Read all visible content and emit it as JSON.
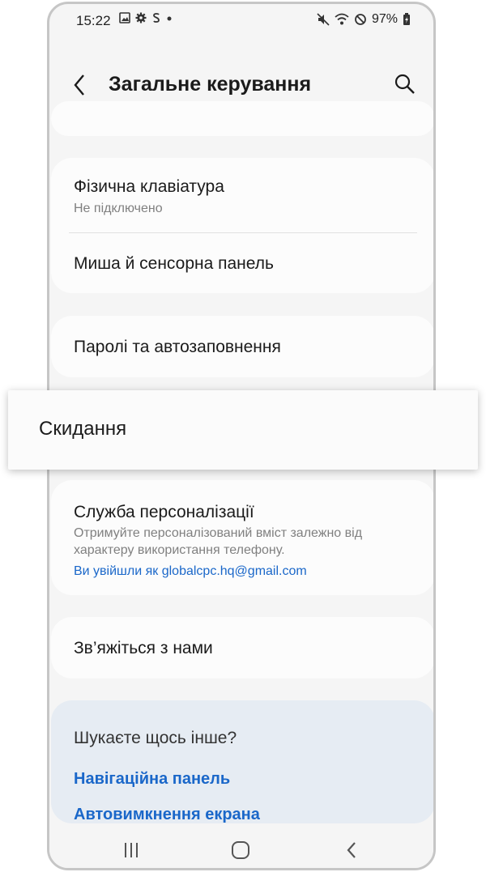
{
  "status_bar": {
    "time": "15:22",
    "battery": "97%"
  },
  "header": {
    "title": "Загальне керування",
    "back_icon": "chevron-left-icon",
    "search_icon": "search-icon"
  },
  "items": {
    "keyboard_title": "Фізична клавіатура",
    "keyboard_sub": "Не підключено",
    "mouse_title": "Миша й сенсорна панель",
    "passwords_title": "Паролі та автозаповнення",
    "reset_title": "Скидання",
    "personal_title": "Служба персоналізації",
    "personal_sub1": "Отримуйте персоналізований вміст залежно від",
    "personal_sub2": "характеру використання телефону.",
    "personal_link": "Ви увійшли як globalcpc.hq@gmail.com",
    "contact_title": "Зв’яжіться з нами"
  },
  "suggestions": {
    "title": "Шукаєте щось інше?",
    "link1": "Навігаційна панель",
    "link2": "Автовимкнення екрана"
  },
  "colors": {
    "accent": "#1a67c9",
    "background": "#f5f5f5",
    "card": "#fcfcfc",
    "suggest_bg": "#e6ecf3"
  }
}
